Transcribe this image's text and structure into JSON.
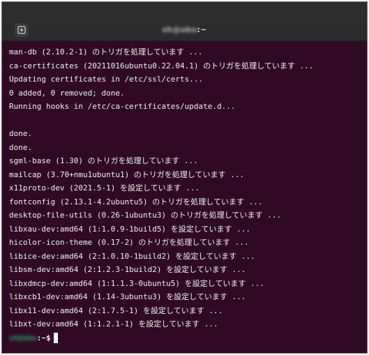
{
  "window": {
    "title_user": "sh",
    "title_host_blurred": "@ubu",
    "title_suffix": ":~"
  },
  "terminal": {
    "lines": [
      "man-db (2.10.2-1) のトリガを処理しています ...",
      "ca-certificates (20211016ubuntu0.22.04.1) のトリガを処理しています ...",
      "Updating certificates in /etc/ssl/certs...",
      "0 added, 0 removed; done.",
      "Running hooks in /etc/ca-certificates/update.d...",
      "",
      "done.",
      "done.",
      "sgml-base (1.30) のトリガを処理しています ...",
      "mailcap (3.70+nmu1ubuntu1) のトリガを処理しています ...",
      "x11proto-dev (2021.5-1) を設定しています ...",
      "fontconfig (2.13.1-4.2ubuntu5) のトリガを処理しています ...",
      "desktop-file-utils (0.26-1ubuntu3) のトリガを処理しています ...",
      "libxau-dev:amd64 (1:1.0.9-1build5) を設定しています ...",
      "hicolor-icon-theme (0.17-2) のトリガを処理しています ...",
      "libice-dev:amd64 (2:1.0.10-1build2) を設定しています ...",
      "libsm-dev:amd64 (2:1.2.3-1build2) を設定しています ...",
      "libxdmcp-dev:amd64 (1:1.1.3-0ubuntu5) を設定しています ...",
      "libxcb1-dev:amd64 (1.14-3ubuntu3) を設定しています ...",
      "libx11-dev:amd64 (2:1.7.5-1) を設定しています ...",
      "libxt-dev:amd64 (1:1.2.1-1) を設定しています ..."
    ],
    "prompt_user": "sh@ubu",
    "prompt_suffix": ":~$"
  },
  "colors": {
    "background": "#300a24",
    "prompt_user": "#26a269",
    "text": "#f0f0f0"
  },
  "icons": {
    "new_tab": "new-tab-icon"
  }
}
